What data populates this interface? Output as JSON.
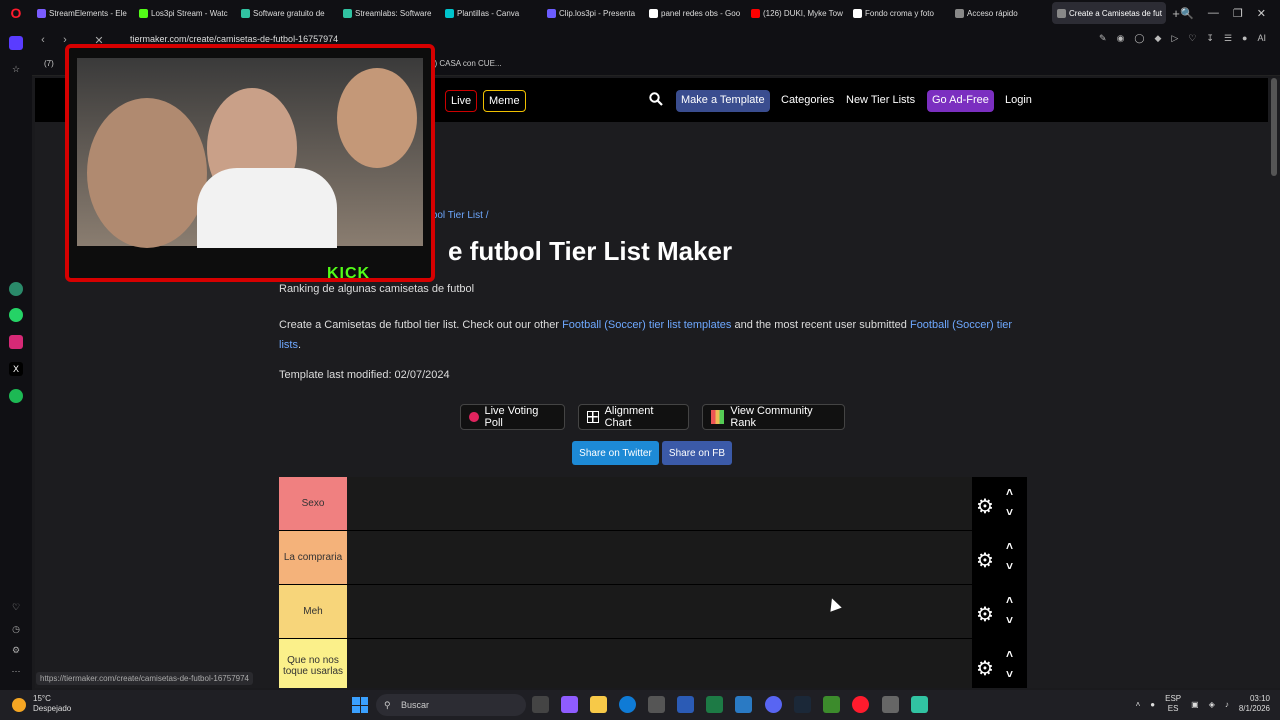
{
  "browser": {
    "tabs": [
      {
        "label": "StreamElements - Ele",
        "color": "#7a5cff"
      },
      {
        "label": "Los3pi Stream - Watc",
        "color": "#53fc18"
      },
      {
        "label": "Software gratuito de",
        "color": "#31c3a2"
      },
      {
        "label": "Streamlabs: Software",
        "color": "#31c3a2"
      },
      {
        "label": "Plantillas - Canva",
        "color": "#00c4cc"
      },
      {
        "label": "Clip.los3pi - Presenta",
        "color": "#6b5cff"
      },
      {
        "label": "panel redes obs - Goo",
        "color": "#ffffff"
      },
      {
        "label": "(126) DUKI, Myke Tow",
        "color": "#ff0000"
      },
      {
        "label": "Fondo croma y foto",
        "color": "#ffffff"
      },
      {
        "label": "Acceso rápido",
        "color": "#888888"
      },
      {
        "label": "Create a Camisetas de fut",
        "color": "#888888",
        "active": true
      }
    ],
    "url": "tiermaker.com/create/camisetas-de-futbol-16757974",
    "bookmarks": [
      "(7)",
      "7) CASA con CUE..."
    ],
    "status_url": "https://tiermaker.com/create/camisetas-de-futbol-16757974"
  },
  "site": {
    "nav": {
      "live": "Live",
      "meme": "Meme",
      "make_template": "Make a Template",
      "categories": "Categories",
      "new_tier_lists": "New Tier Lists",
      "ad_free": "Go Ad-Free",
      "login": "Login"
    },
    "breadcrumb": "tbol Tier List /",
    "title": "e futbol Tier List Maker",
    "subtitle": "Ranking de algunas camisetas de futbol",
    "description": {
      "part1": "Create a Camisetas de futbol tier list. Check out our other ",
      "link1": "Football (Soccer) tier list templates",
      "part2": " and the most recent user submitted ",
      "link2": "Football (Soccer) tier lists",
      "part3": "."
    },
    "modified": "Template last modified: 02/07/2024",
    "buttons": {
      "voting": "Live Voting Poll",
      "alignment": "Alignment Chart",
      "community": "View Community Rank",
      "twitter": "Share on Twitter",
      "fb": "Share on FB"
    },
    "tiers": [
      {
        "label": "Sexo",
        "color": "#f08080"
      },
      {
        "label": "La compraria",
        "color": "#f4b27a"
      },
      {
        "label": "Meh",
        "color": "#f7d57a"
      },
      {
        "label": "Que no nos toque usarlas",
        "color": "#fbf08a"
      }
    ]
  },
  "overlay": {
    "kick": "KICK"
  },
  "taskbar": {
    "weather_temp": "15°C",
    "weather_desc": "Despejado",
    "search": "Buscar",
    "lang1": "ESP",
    "lang2": "ES",
    "time": "03:10",
    "date": "8/1/2026"
  }
}
